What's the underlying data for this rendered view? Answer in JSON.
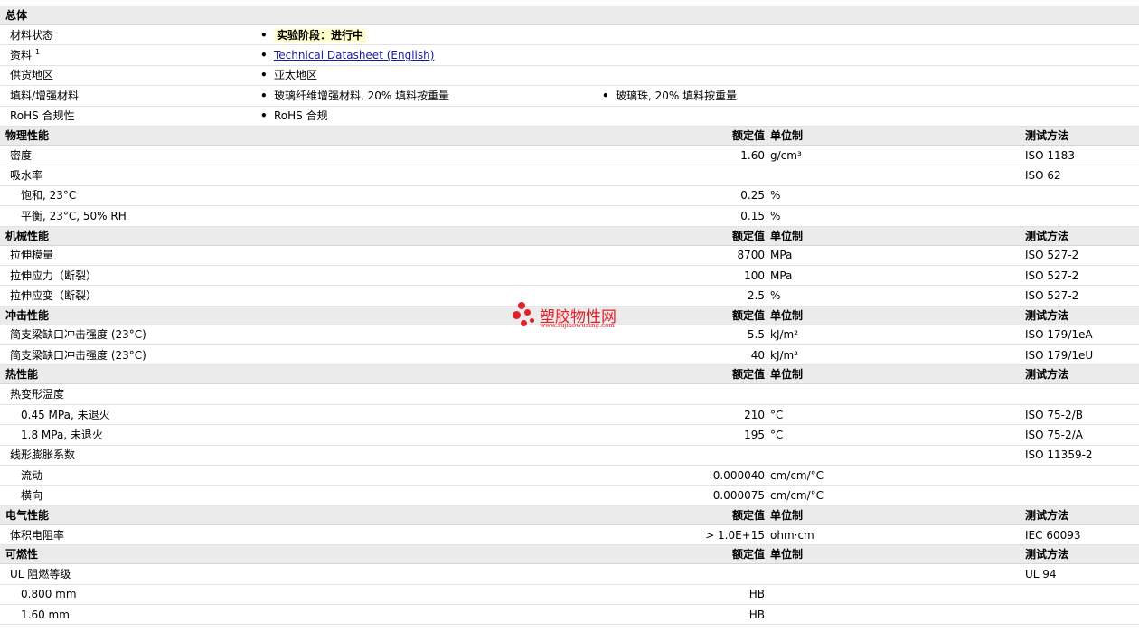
{
  "sections": {
    "general": {
      "title": "总体",
      "material_status": {
        "label": "材料状态",
        "value": "实验阶段：进行中"
      },
      "info": {
        "label": "资料",
        "sup": "1",
        "value": "Technical Datasheet (English)"
      },
      "availability": {
        "label": "供货地区",
        "value": "亚太地区"
      },
      "filler": {
        "label": "填料/增强材料",
        "value1": "玻璃纤维增强材料, 20% 填料按重量",
        "value2": "玻璃珠, 20% 填料按重量"
      },
      "rohs": {
        "label": "RoHS 合规性",
        "value": "RoHS 合规"
      }
    },
    "header": {
      "nominal": "额定值",
      "unit": "单位制",
      "method": "测试方法"
    },
    "physical": {
      "title": "物理性能",
      "rows": [
        {
          "label": "密度",
          "value": "1.60",
          "unit": "g/cm³",
          "method": "ISO 1183"
        },
        {
          "label": "吸水率",
          "value": "",
          "unit": "",
          "method": "ISO 62"
        },
        {
          "label": "饱和, 23°C",
          "value": "0.25",
          "unit": "%",
          "method": ""
        },
        {
          "label": "平衡, 23°C, 50% RH",
          "value": "0.15",
          "unit": "%",
          "method": ""
        }
      ]
    },
    "mechanical": {
      "title": "机械性能",
      "rows": [
        {
          "label": "拉伸模量",
          "value": "8700",
          "unit": "MPa",
          "method": "ISO 527-2"
        },
        {
          "label": "拉伸应力（断裂）",
          "value": "100",
          "unit": "MPa",
          "method": "ISO 527-2"
        },
        {
          "label": "拉伸应变（断裂）",
          "value": "2.5",
          "unit": "%",
          "method": "ISO 527-2"
        }
      ]
    },
    "impact": {
      "title": "冲击性能",
      "rows": [
        {
          "label": "简支梁缺口冲击强度 (23°C)",
          "value": "5.5",
          "unit": "kJ/m²",
          "method": "ISO 179/1eA"
        },
        {
          "label": "简支梁缺口冲击强度 (23°C)",
          "value": "40",
          "unit": "kJ/m²",
          "method": "ISO 179/1eU"
        }
      ]
    },
    "thermal": {
      "title": "热性能",
      "rows": [
        {
          "label": "热变形温度",
          "value": "",
          "unit": "",
          "method": ""
        },
        {
          "label": "0.45 MPa, 未退火",
          "value": "210",
          "unit": "°C",
          "method": "ISO 75-2/B"
        },
        {
          "label": "1.8 MPa, 未退火",
          "value": "195",
          "unit": "°C",
          "method": "ISO 75-2/A"
        },
        {
          "label": "线形膨胀系数",
          "value": "",
          "unit": "",
          "method": "ISO 11359-2"
        },
        {
          "label": "流动",
          "value": "0.000040",
          "unit": "cm/cm/°C",
          "method": ""
        },
        {
          "label": "横向",
          "value": "0.000075",
          "unit": "cm/cm/°C",
          "method": ""
        }
      ]
    },
    "electrical": {
      "title": "电气性能",
      "rows": [
        {
          "label": "体积电阻率",
          "value": "> 1.0E+15",
          "unit": "ohm·cm",
          "method": "IEC 60093"
        }
      ]
    },
    "flammability": {
      "title": "可燃性",
      "rows": [
        {
          "label": "UL 阻燃等级",
          "value": "",
          "unit": "",
          "method": "UL 94"
        },
        {
          "label": "0.800 mm",
          "value": "HB",
          "unit": "",
          "method": ""
        },
        {
          "label": "1.60 mm",
          "value": "HB",
          "unit": "",
          "method": ""
        }
      ]
    }
  },
  "watermark": {
    "name": "塑胶物性网",
    "url": "www.sujiaowuxing.com"
  },
  "colors": {
    "section_bg": "#ebebeb",
    "status_bg": "#ffffcc",
    "link": "#1a1aa6",
    "watermark": "#e0202a"
  }
}
